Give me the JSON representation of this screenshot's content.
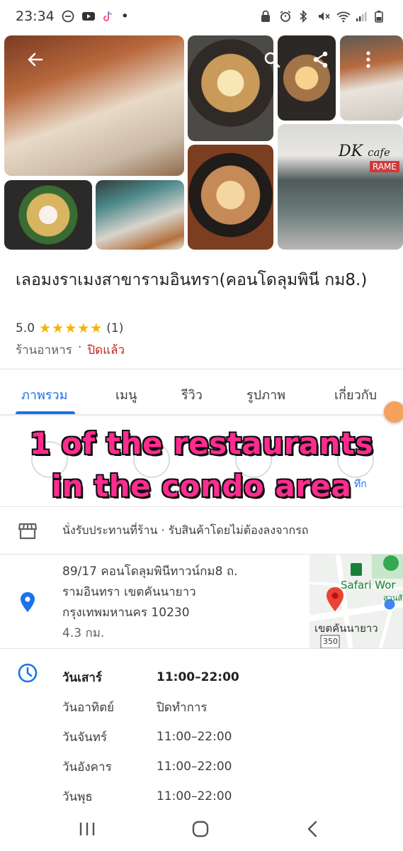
{
  "status_bar": {
    "time": "23:34",
    "dot": "•",
    "icons_left": [
      "do-not-disturb-icon",
      "youtube-icon",
      "tiktok-icon"
    ],
    "icons_right": [
      "lock-icon",
      "alarm-icon",
      "bluetooth-icon",
      "mute-icon",
      "wifi-icon",
      "signal-icon",
      "battery-icon"
    ]
  },
  "photos": {
    "storefront_sign": "DK",
    "storefront_sign_script": "cafe",
    "storefront_banner": "RAME"
  },
  "place": {
    "title": "เลอมงราเมงสาขารามอินทรา(คอนโดลุมพินี กม8.)",
    "rating": "5.0",
    "stars": 5,
    "review_count": "(1)",
    "category": "ร้านอาหาร",
    "separator": "·",
    "status": "ปิดแล้ว"
  },
  "tabs": [
    {
      "label": "ภาพรวม"
    },
    {
      "label": "เมนู"
    },
    {
      "label": "รีวิว"
    },
    {
      "label": "รูปภาพ"
    },
    {
      "label": "เกี่ยวกับ"
    }
  ],
  "actions": {
    "save_label_partial": "ทึก"
  },
  "overlay_caption": {
    "line1": "1 of the restaurants",
    "line2": "in the condo area"
  },
  "service_options": "นั่งรับประทานที่ร้าน · รับสินค้าโดยไม่ต้องลงจากรถ",
  "address": {
    "line1": "89/17 คอนโดลุมพินีทาวน์กม8 ถ.",
    "line2": "รามอินทรา เขตคันนายาว",
    "line3": "กรุงเทพมหานคร 10230",
    "distance": "4.3 กม."
  },
  "map": {
    "poi_label": "Safari Wor",
    "district_label": "เขตคันนายาว",
    "road_number": "350",
    "partial_label": "สวนสั",
    "colors": {
      "pin": "#ea4335",
      "road": "#ffffff",
      "park": "#c8e6c9",
      "water": "#aadaff"
    }
  },
  "hours": [
    {
      "day": "วันเสาร์",
      "time": "11:00–22:00",
      "today": true
    },
    {
      "day": "วันอาทิตย์",
      "time": "ปิดทำการ",
      "today": false
    },
    {
      "day": "วันจันทร์",
      "time": "11:00–22:00",
      "today": false
    },
    {
      "day": "วันอังคาร",
      "time": "11:00–22:00",
      "today": false
    },
    {
      "day": "วันพุธ",
      "time": "11:00–22:00",
      "today": false
    }
  ],
  "colors": {
    "accent": "#1a73e8",
    "closed": "#c5221f",
    "star": "#f4b400",
    "caption": "#ff2c8f"
  }
}
